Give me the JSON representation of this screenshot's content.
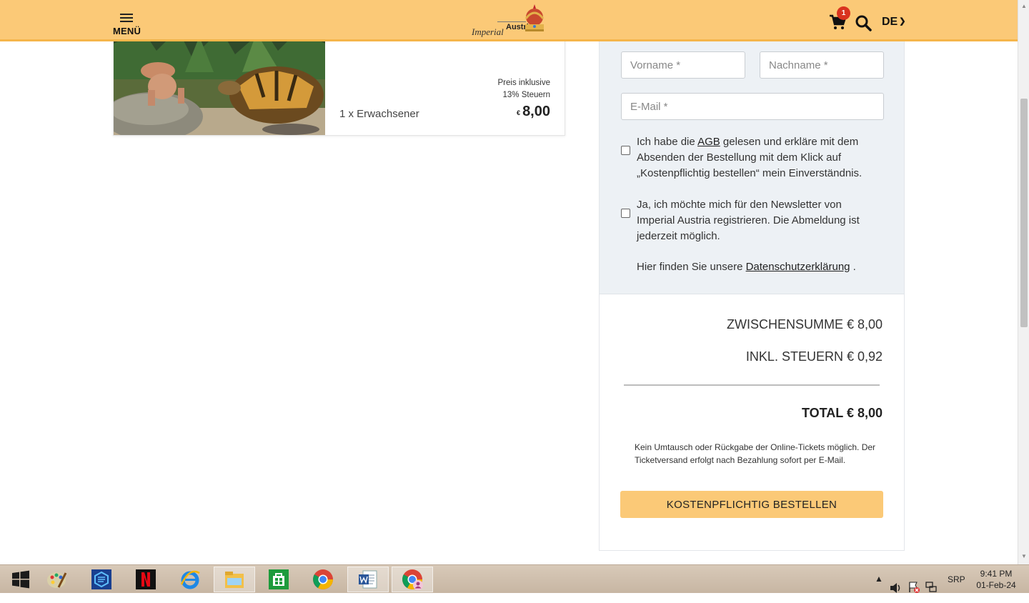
{
  "header": {
    "menu_label": "MENÜ",
    "logo_text_imperial": "Imperial",
    "logo_text_austria": "Austria",
    "cart_count": "1",
    "language": "DE",
    "brand_color": "#fbc977"
  },
  "ticket": {
    "price_note_line1": "Preis inklusive",
    "price_note_line2": "13% Steuern",
    "quantity_label": "1 x Erwachsener",
    "currency": "€",
    "price": "8,00"
  },
  "form": {
    "first_name_placeholder": "Vorname *",
    "last_name_placeholder": "Nachname *",
    "email_placeholder": "E-Mail *",
    "terms_prefix": "Ich habe die ",
    "terms_link": "AGB",
    "terms_suffix": " gelesen und erkläre mit dem Absenden der Bestellung mit dem Klick auf „Kostenpflichtig bestellen“ mein Einverständnis.",
    "newsletter_text": "Ja, ich möchte mich für den Newsletter von Imperial Austria registrieren. Die Abmeldung ist jederzeit möglich.",
    "privacy_prefix": "Hier finden Sie unsere ",
    "privacy_link": "Datenschutzerklärung",
    "privacy_suffix": " ."
  },
  "summary": {
    "subtotal": "ZWISCHENSUMME € 8,00",
    "tax": "INKL. STEUERN € 0,92",
    "total": "TOTAL € 8,00",
    "notice": "Kein Umtausch oder Rückgabe der Online-Tickets möglich. Der Ticketversand erfolgt nach Bezahlung sofort per E-Mail.",
    "order_button": "KOSTENPFLICHTIG BESTELLEN"
  },
  "taskbar": {
    "language": "SRP",
    "time": "9:41 PM",
    "date": "01-Feb-24",
    "apps": [
      "start-icon",
      "paint-icon",
      "app-icon",
      "netflix-icon",
      "ie-icon",
      "file-explorer-icon",
      "store-icon",
      "chrome-icon",
      "word-icon",
      "chrome-profile-icon"
    ]
  }
}
